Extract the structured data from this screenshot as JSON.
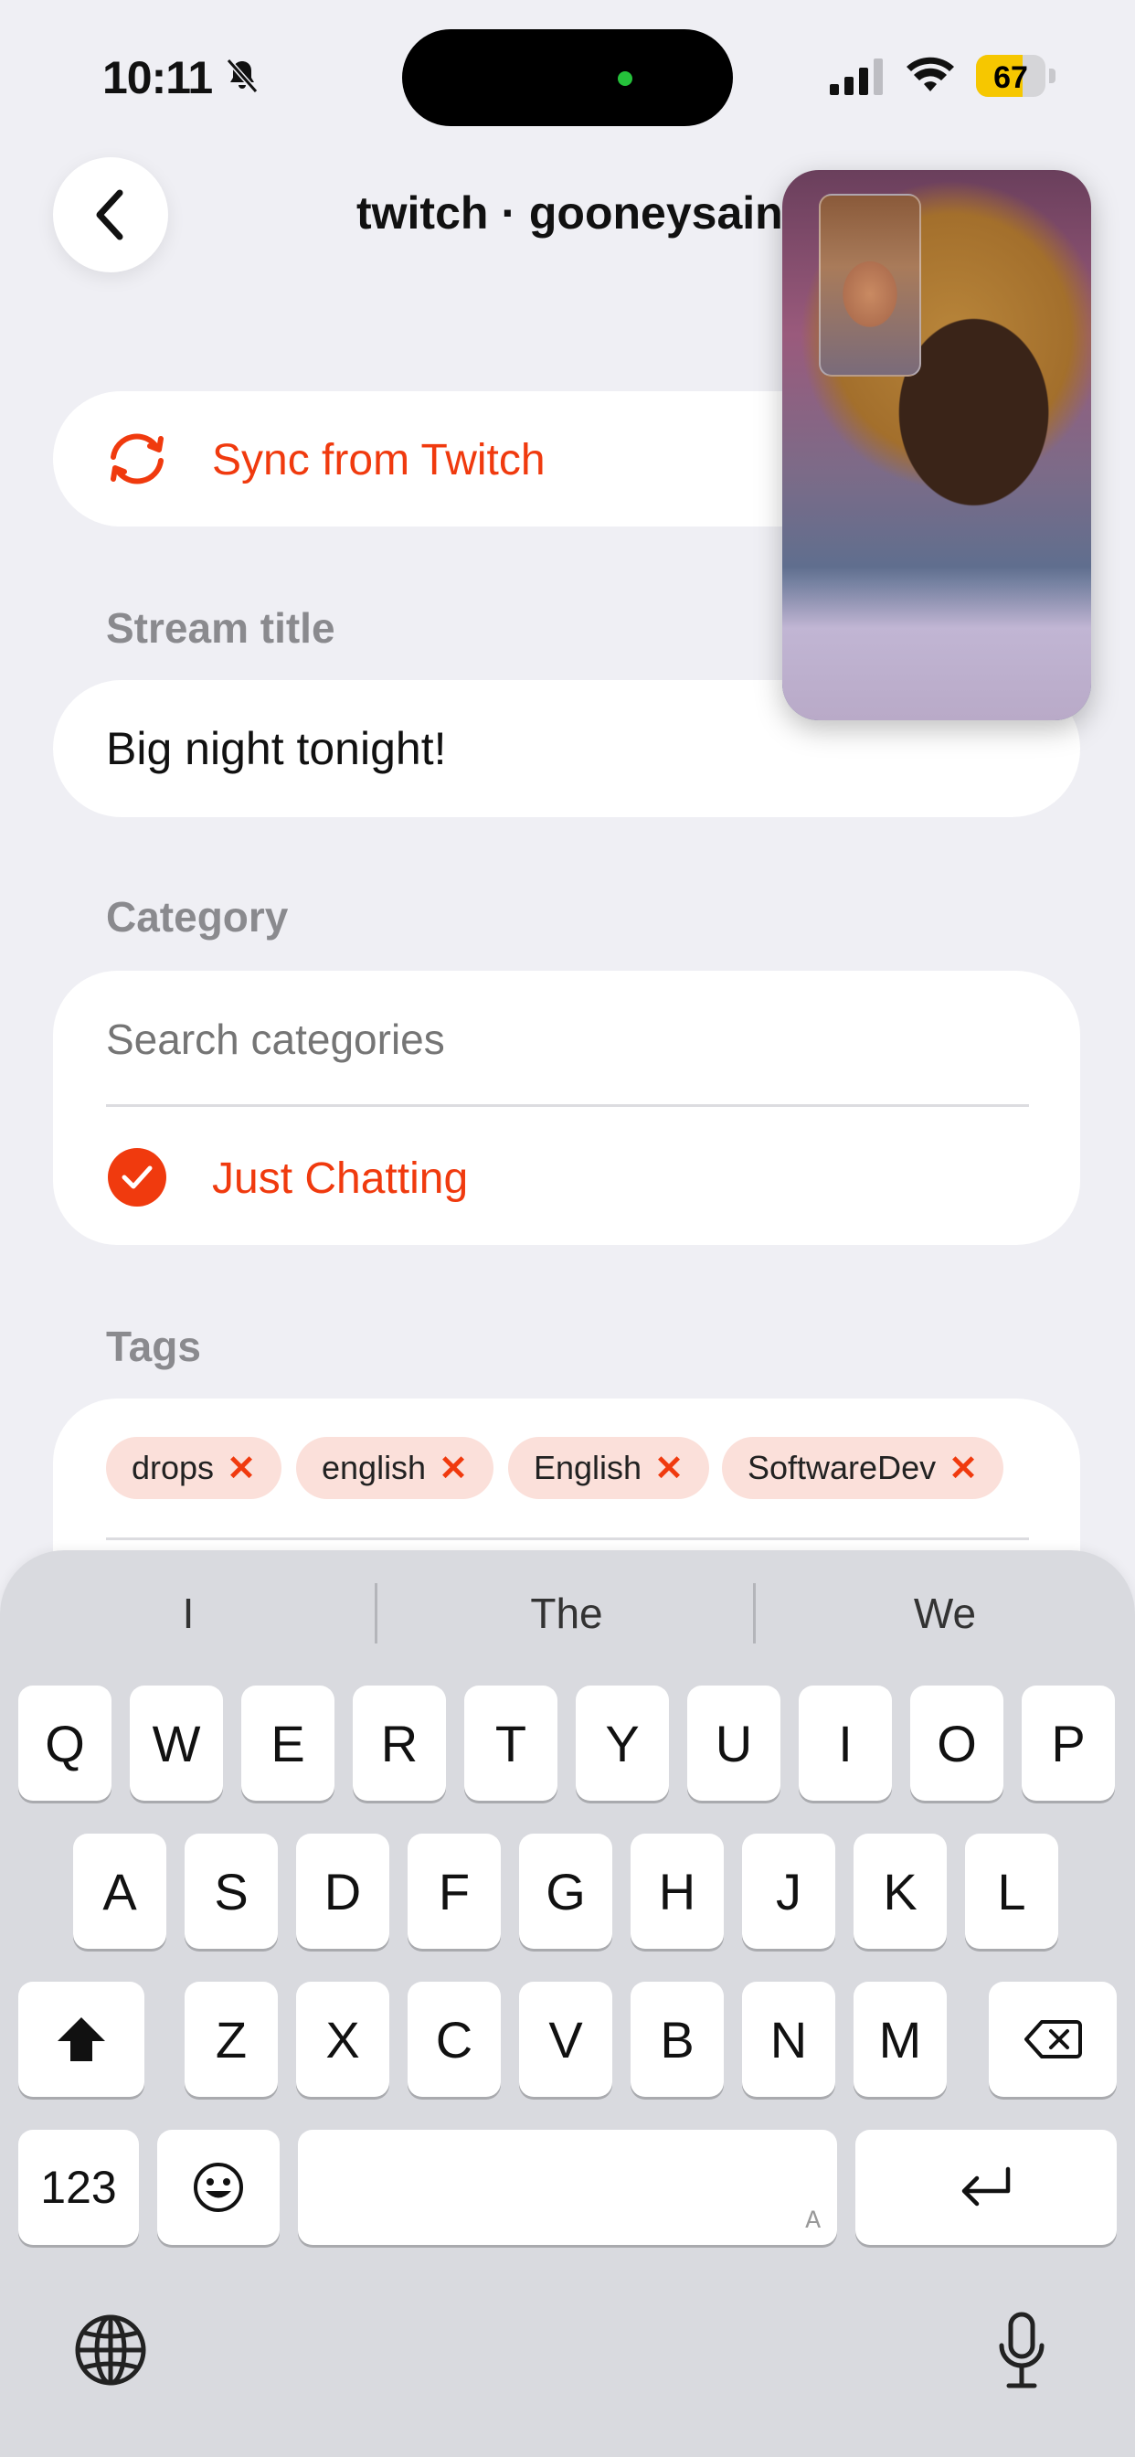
{
  "status_bar": {
    "time": "10:11",
    "battery_level": "67",
    "battery_fraction": 0.67,
    "icons": [
      "bell-slash-icon",
      "signal-icon",
      "wifi-icon",
      "battery-icon"
    ]
  },
  "nav": {
    "title": "twitch · gooneysaint"
  },
  "sync": {
    "label": "Sync from Twitch"
  },
  "stream_title": {
    "label": "Stream title",
    "value": "Big night tonight!"
  },
  "category": {
    "label": "Category",
    "search_placeholder": "Search categories",
    "selected": "Just Chatting"
  },
  "tags": {
    "label": "Tags",
    "items": [
      "drops",
      "english",
      "English",
      "SoftwareDev"
    ]
  },
  "keyboard": {
    "suggestions": [
      "I",
      "The",
      "We"
    ],
    "row1": [
      "Q",
      "W",
      "E",
      "R",
      "T",
      "Y",
      "U",
      "I",
      "O",
      "P"
    ],
    "row2": [
      "A",
      "S",
      "D",
      "F",
      "G",
      "H",
      "J",
      "K",
      "L"
    ],
    "row3": [
      "Z",
      "X",
      "C",
      "V",
      "B",
      "N",
      "M"
    ],
    "numbers_key": "123",
    "space_hint": "A"
  },
  "colors": {
    "accent": "#f03a0e",
    "background": "#efeff4",
    "tag_bg": "#fbe0da"
  }
}
